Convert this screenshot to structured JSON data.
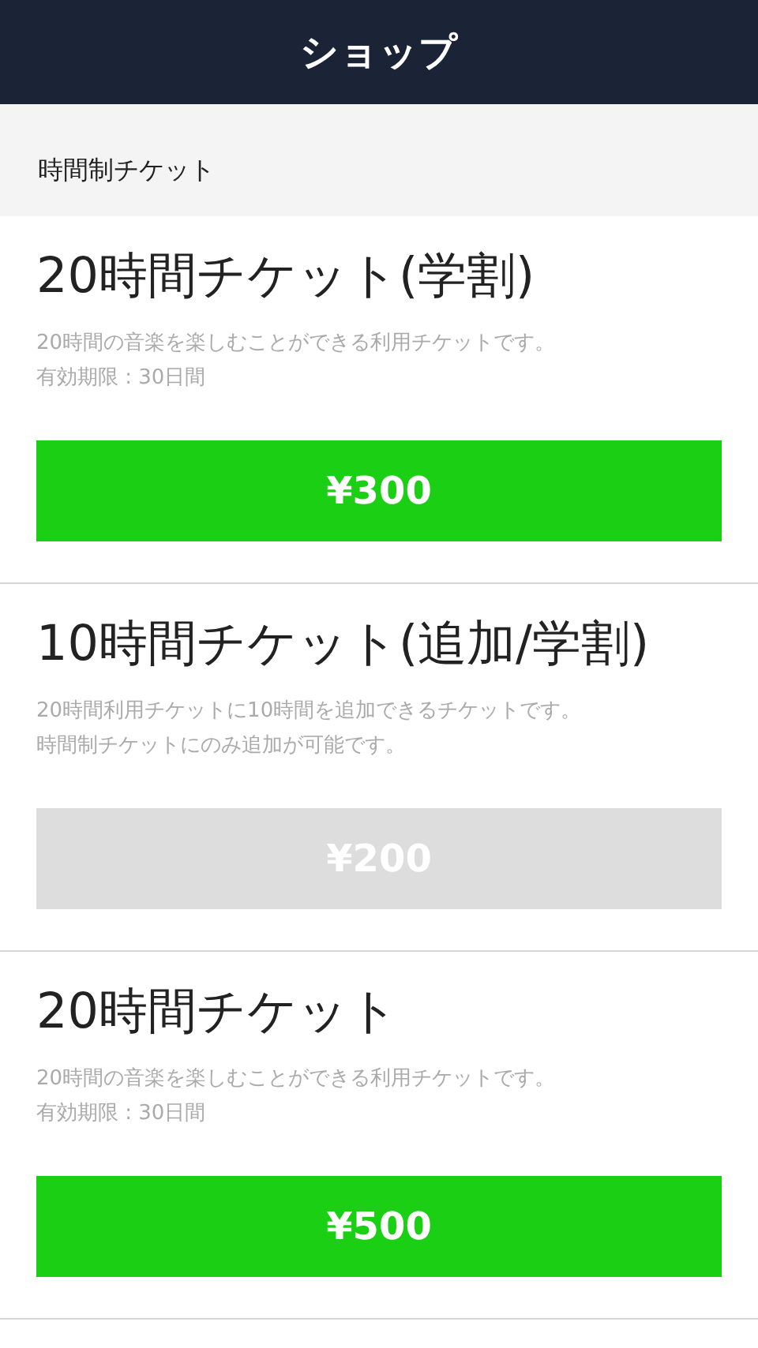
{
  "header": {
    "title": "ショップ"
  },
  "section": {
    "label": "時間制チケット"
  },
  "tickets": [
    {
      "title": "20時間チケット(学割)",
      "lines": [
        "20時間の音楽を楽しむことができる利用チケットです。",
        "有効期限 : 30日間"
      ],
      "price": "¥300",
      "disabled": false
    },
    {
      "title": "10時間チケット(追加/学割)",
      "lines": [
        "20時間利用チケットに10時間を追加できるチケットです。",
        "時間制チケットにのみ追加が可能です。"
      ],
      "price": "¥200",
      "disabled": true
    },
    {
      "title": "20時間チケット",
      "lines": [
        "20時間の音楽を楽しむことができる利用チケットです。",
        "有効期限 : 30日間"
      ],
      "price": "¥500",
      "disabled": false
    }
  ]
}
